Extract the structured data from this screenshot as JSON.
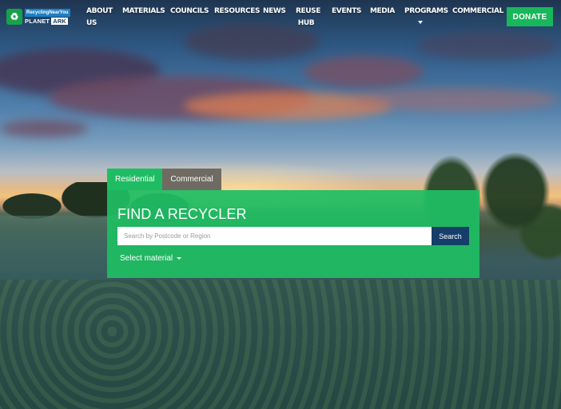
{
  "brand": {
    "logo_top": "RecyclingNearYou",
    "logo_planet": "PLANET",
    "logo_ark": "ARK",
    "accent_color": "#19b75b",
    "secondary_color": "#153e6a"
  },
  "nav": {
    "items": [
      {
        "line1": "ABOUT",
        "line2": "US"
      },
      {
        "line1": "MATERIALS"
      },
      {
        "line1": "COUNCILS"
      },
      {
        "line1": "RESOURCES"
      },
      {
        "line1": "NEWS"
      },
      {
        "line1": "REUSE",
        "line2": "HUB"
      },
      {
        "line1": "EVENTS"
      },
      {
        "line1": "MEDIA"
      },
      {
        "line1": "PROGRAMS",
        "has_dropdown": true
      },
      {
        "line1": "COMMERCIAL"
      }
    ],
    "donate_label": "DONATE"
  },
  "finder": {
    "tabs": [
      {
        "label": "Residential",
        "active": true
      },
      {
        "label": "Commercial",
        "active": false
      }
    ],
    "title": "FIND A RECYCLER",
    "search_value": "",
    "search_placeholder": "Search by Postcode or Region",
    "search_button": "Search",
    "select_material": "Select material"
  },
  "icons": {
    "logo": "recycle-icon",
    "programs_dropdown": "chevron-down-icon",
    "material_dropdown": "chevron-down-icon"
  }
}
